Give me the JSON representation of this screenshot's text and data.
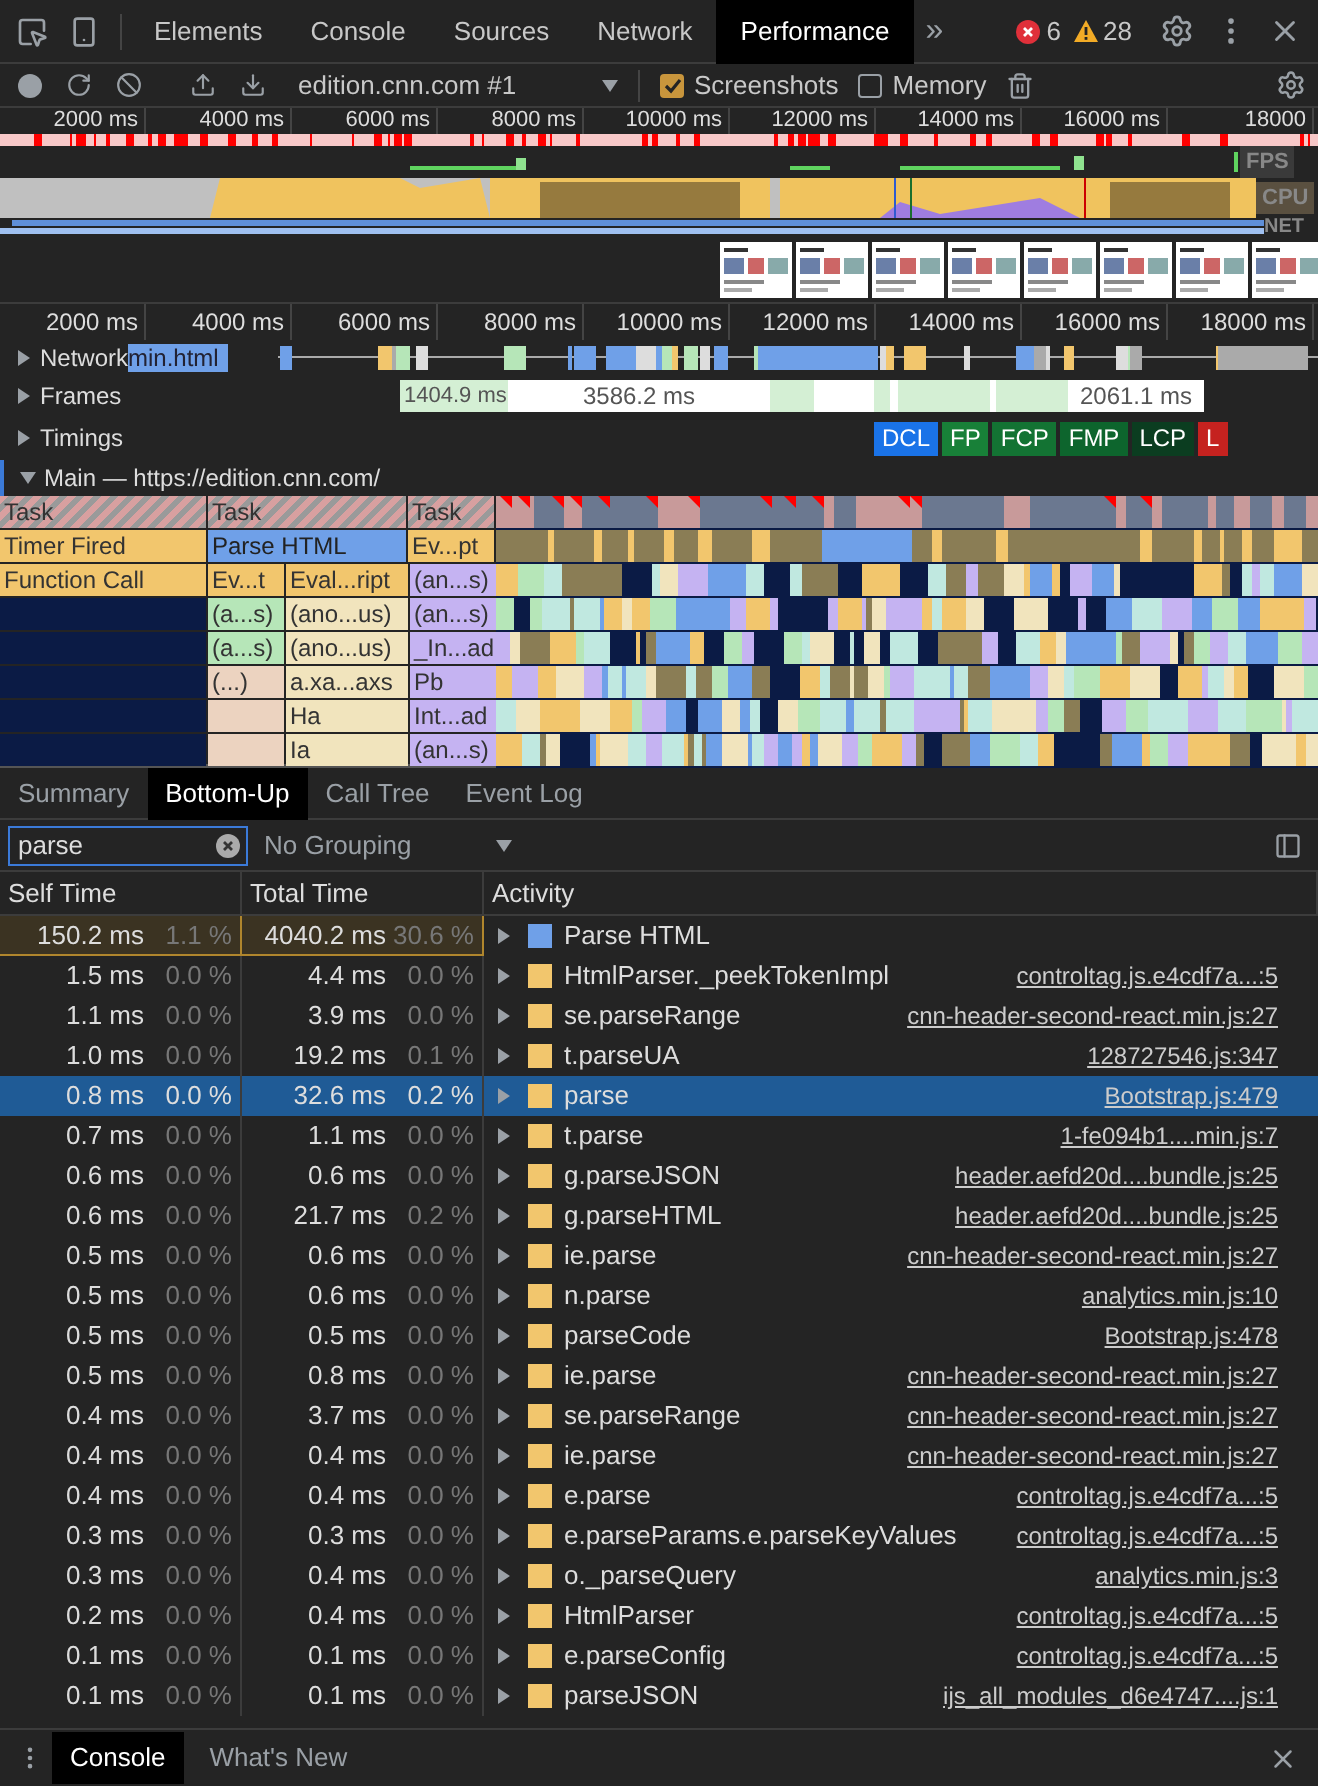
{
  "main_tabs": [
    {
      "label": "Elements",
      "selected": false
    },
    {
      "label": "Console",
      "selected": false
    },
    {
      "label": "Sources",
      "selected": false
    },
    {
      "label": "Network",
      "selected": false
    },
    {
      "label": "Performance",
      "selected": true
    }
  ],
  "more_tabs": "»",
  "errors": "6",
  "warnings": "28",
  "toolbar": {
    "recording": "edition.cnn.com #1",
    "options": [
      {
        "label": "Screenshots",
        "checked": true
      },
      {
        "label": "Memory",
        "checked": false
      }
    ]
  },
  "overview": {
    "ticks": [
      "2000 ms",
      "4000 ms",
      "6000 ms",
      "8000 ms",
      "10000 ms",
      "12000 ms",
      "14000 ms",
      "16000 ms",
      "18000"
    ],
    "lanes": [
      "FPS",
      "CPU",
      "NET"
    ]
  },
  "timeline": {
    "ticks": [
      "2000 ms",
      "4000 ms",
      "6000 ms",
      "8000 ms",
      "10000 ms",
      "12000 ms",
      "14000 ms",
      "16000 ms",
      "18000 ms"
    ],
    "network": {
      "label": "Network",
      "expanded": false,
      "request": "min.html"
    },
    "frames": {
      "label": "Frames",
      "expanded": false,
      "segments": [
        "1404.9 ms",
        "3586.2 ms",
        "2061.1 ms"
      ]
    },
    "timings": {
      "label": "Timings",
      "expanded": false,
      "markers": [
        {
          "label": "DCL",
          "color": "#1a73e8"
        },
        {
          "label": "FP",
          "color": "#188038"
        },
        {
          "label": "FCP",
          "color": "#137333"
        },
        {
          "label": "FMP",
          "color": "#0d652d"
        },
        {
          "label": "LCP",
          "color": "#0b3d20"
        },
        {
          "label": "L",
          "color": "#c5221f"
        }
      ]
    },
    "main": {
      "label": "Main — https://edition.cnn.com/",
      "expanded": true
    },
    "flame_rows": [
      [
        {
          "label": "Task",
          "kind": "task"
        },
        {
          "label": "Task",
          "kind": "task"
        },
        {
          "label": "Task",
          "kind": "task"
        }
      ],
      [
        {
          "label": "Timer Fired",
          "kind": "timer"
        },
        {
          "label": "Parse HTML",
          "kind": "parse"
        },
        {
          "label": "Ev...pt",
          "kind": "timer"
        }
      ],
      [
        {
          "label": "Function Call",
          "kind": "timer"
        },
        {
          "label": "Ev...t",
          "kind": "timer"
        },
        {
          "label": "Eval...ript",
          "kind": "timer"
        },
        {
          "label": "(an...s)",
          "kind": "purple"
        }
      ],
      [
        {
          "kind": "idle"
        },
        {
          "label": "(a...s)",
          "kind": "green"
        },
        {
          "label": "(ano...us)",
          "kind": "beige"
        },
        {
          "label": "(an...s)",
          "kind": "purple"
        }
      ],
      [
        {
          "kind": "idle"
        },
        {
          "label": "(a...s)",
          "kind": "green"
        },
        {
          "label": "(ano...us)",
          "kind": "beige"
        },
        {
          "label": "_In...ad",
          "kind": "purple"
        }
      ],
      [
        {
          "kind": "idle"
        },
        {
          "label": "(...)",
          "kind": "peach"
        },
        {
          "label": "a.xa...axs",
          "kind": "beige"
        },
        {
          "label": "Pb",
          "kind": "purple"
        }
      ],
      [
        {
          "kind": "idle"
        },
        {
          "kind": "peach"
        },
        {
          "label": "Ha",
          "kind": "beige"
        },
        {
          "label": "Int...ad",
          "kind": "purple"
        }
      ],
      [
        {
          "kind": "idle"
        },
        {
          "kind": "peach"
        },
        {
          "label": "Ia",
          "kind": "beige"
        },
        {
          "label": "(an...s)",
          "kind": "purple"
        }
      ]
    ]
  },
  "detail_tabs": [
    {
      "label": "Summary",
      "selected": false
    },
    {
      "label": "Bottom-Up",
      "selected": true
    },
    {
      "label": "Call Tree",
      "selected": false
    },
    {
      "label": "Event Log",
      "selected": false
    }
  ],
  "filter": {
    "value": "parse"
  },
  "grouping": "No Grouping",
  "table": {
    "columns": [
      "Self Time",
      "Total Time",
      "Activity"
    ],
    "rows": [
      {
        "self": "150.2 ms",
        "self_pct": "1.1 %",
        "total": "4040.2 ms",
        "total_pct": "30.6 %",
        "activity": "Parse HTML",
        "color": "#6fa0e8",
        "source": "",
        "selected": false,
        "highlighted": true
      },
      {
        "self": "1.5 ms",
        "self_pct": "0.0 %",
        "total": "4.4 ms",
        "total_pct": "0.0 %",
        "activity": "HtmlParser._peekTokenImpl",
        "color": "#f2c66d",
        "source": "controltag.js.e4cdf7a...:5",
        "selected": false,
        "highlighted": false
      },
      {
        "self": "1.1 ms",
        "self_pct": "0.0 %",
        "total": "3.9 ms",
        "total_pct": "0.0 %",
        "activity": "se.parseRange",
        "color": "#f2c66d",
        "source": "cnn-header-second-react.min.js:27",
        "selected": false,
        "highlighted": false
      },
      {
        "self": "1.0 ms",
        "self_pct": "0.0 %",
        "total": "19.2 ms",
        "total_pct": "0.1 %",
        "activity": "t.parseUA",
        "color": "#f2c66d",
        "source": "128727546.js:347",
        "selected": false,
        "highlighted": false
      },
      {
        "self": "0.8 ms",
        "self_pct": "0.0 %",
        "total": "32.6 ms",
        "total_pct": "0.2 %",
        "activity": "parse",
        "color": "#f2c66d",
        "source": "Bootstrap.js:479",
        "selected": true,
        "highlighted": false
      },
      {
        "self": "0.7 ms",
        "self_pct": "0.0 %",
        "total": "1.1 ms",
        "total_pct": "0.0 %",
        "activity": "t.parse",
        "color": "#f2c66d",
        "source": "1-fe094b1....min.js:7",
        "selected": false,
        "highlighted": false
      },
      {
        "self": "0.6 ms",
        "self_pct": "0.0 %",
        "total": "0.6 ms",
        "total_pct": "0.0 %",
        "activity": "g.parseJSON",
        "color": "#f2c66d",
        "source": "header.aefd20d....bundle.js:25",
        "selected": false,
        "highlighted": false
      },
      {
        "self": "0.6 ms",
        "self_pct": "0.0 %",
        "total": "21.7 ms",
        "total_pct": "0.2 %",
        "activity": "g.parseHTML",
        "color": "#f2c66d",
        "source": "header.aefd20d....bundle.js:25",
        "selected": false,
        "highlighted": false
      },
      {
        "self": "0.5 ms",
        "self_pct": "0.0 %",
        "total": "0.6 ms",
        "total_pct": "0.0 %",
        "activity": "ie.parse",
        "color": "#f2c66d",
        "source": "cnn-header-second-react.min.js:27",
        "selected": false,
        "highlighted": false
      },
      {
        "self": "0.5 ms",
        "self_pct": "0.0 %",
        "total": "0.6 ms",
        "total_pct": "0.0 %",
        "activity": "n.parse",
        "color": "#f2c66d",
        "source": "analytics.min.js:10",
        "selected": false,
        "highlighted": false
      },
      {
        "self": "0.5 ms",
        "self_pct": "0.0 %",
        "total": "0.5 ms",
        "total_pct": "0.0 %",
        "activity": "parseCode",
        "color": "#f2c66d",
        "source": "Bootstrap.js:478",
        "selected": false,
        "highlighted": false
      },
      {
        "self": "0.5 ms",
        "self_pct": "0.0 %",
        "total": "0.8 ms",
        "total_pct": "0.0 %",
        "activity": "ie.parse",
        "color": "#f2c66d",
        "source": "cnn-header-second-react.min.js:27",
        "selected": false,
        "highlighted": false
      },
      {
        "self": "0.4 ms",
        "self_pct": "0.0 %",
        "total": "3.7 ms",
        "total_pct": "0.0 %",
        "activity": "se.parseRange",
        "color": "#f2c66d",
        "source": "cnn-header-second-react.min.js:27",
        "selected": false,
        "highlighted": false
      },
      {
        "self": "0.4 ms",
        "self_pct": "0.0 %",
        "total": "0.4 ms",
        "total_pct": "0.0 %",
        "activity": "ie.parse",
        "color": "#f2c66d",
        "source": "cnn-header-second-react.min.js:27",
        "selected": false,
        "highlighted": false
      },
      {
        "self": "0.4 ms",
        "self_pct": "0.0 %",
        "total": "0.4 ms",
        "total_pct": "0.0 %",
        "activity": "e.parse",
        "color": "#f2c66d",
        "source": "controltag.js.e4cdf7a...:5",
        "selected": false,
        "highlighted": false
      },
      {
        "self": "0.3 ms",
        "self_pct": "0.0 %",
        "total": "0.3 ms",
        "total_pct": "0.0 %",
        "activity": "e.parseParams.e.parseKeyValues",
        "color": "#f2c66d",
        "source": "controltag.js.e4cdf7a...:5",
        "selected": false,
        "highlighted": false
      },
      {
        "self": "0.3 ms",
        "self_pct": "0.0 %",
        "total": "0.4 ms",
        "total_pct": "0.0 %",
        "activity": "o._parseQuery",
        "color": "#f2c66d",
        "source": "analytics.min.js:3",
        "selected": false,
        "highlighted": false
      },
      {
        "self": "0.2 ms",
        "self_pct": "0.0 %",
        "total": "0.4 ms",
        "total_pct": "0.0 %",
        "activity": "HtmlParser",
        "color": "#f2c66d",
        "source": "controltag.js.e4cdf7a...:5",
        "selected": false,
        "highlighted": false
      },
      {
        "self": "0.1 ms",
        "self_pct": "0.0 %",
        "total": "0.1 ms",
        "total_pct": "0.0 %",
        "activity": "e.parseConfig",
        "color": "#f2c66d",
        "source": "controltag.js.e4cdf7a...:5",
        "selected": false,
        "highlighted": false
      },
      {
        "self": "0.1 ms",
        "self_pct": "0.0 %",
        "total": "0.1 ms",
        "total_pct": "0.0 %",
        "activity": "parseJSON",
        "color": "#f2c66d",
        "source": "ijs_all_modules_d6e4747....js:1",
        "selected": false,
        "highlighted": false
      }
    ]
  },
  "drawer_tabs": [
    {
      "label": "Console",
      "selected": true
    },
    {
      "label": "What's New",
      "selected": false
    }
  ]
}
